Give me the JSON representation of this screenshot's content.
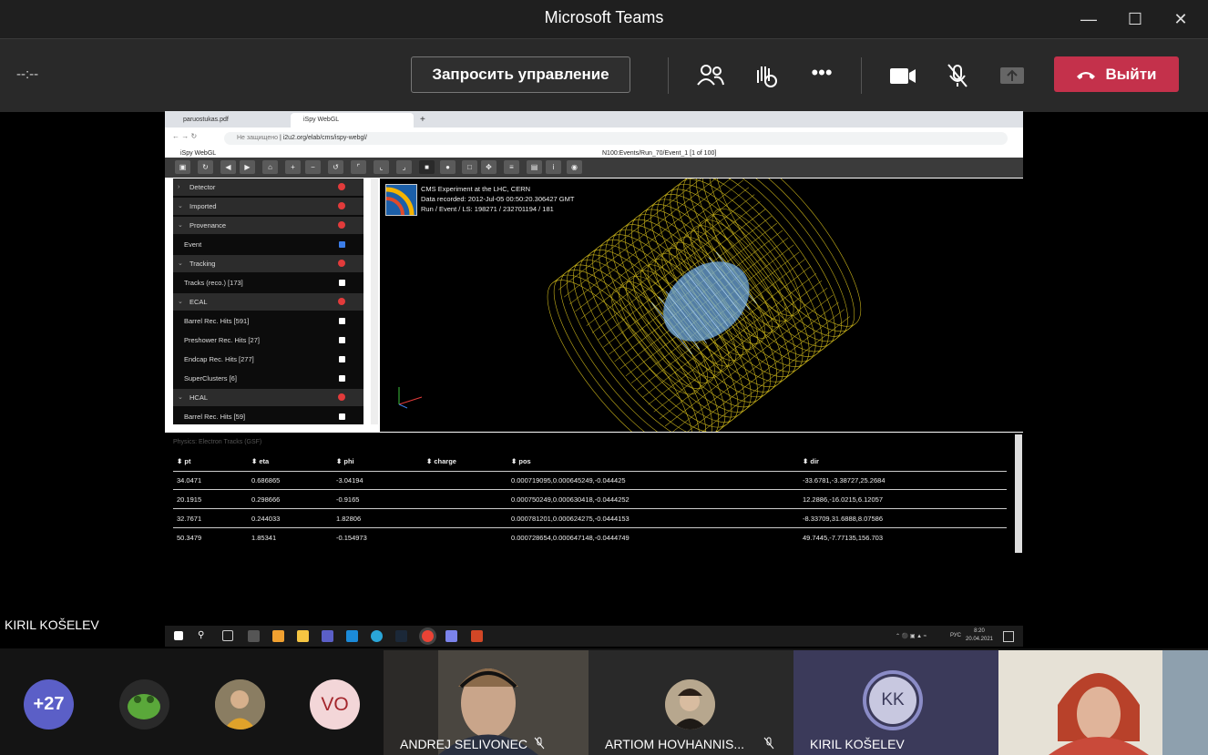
{
  "window": {
    "title": "Microsoft Teams"
  },
  "toolbar": {
    "timer": "--:--",
    "request_control": "Запросить управление",
    "leave": "Выйти"
  },
  "browser": {
    "tabs": [
      "paruostukas.pdf",
      "iSpy WebGL"
    ],
    "url_prefix": "Не защищено",
    "url": "i2u2.org/elab/cms/ispy-webgl/"
  },
  "ispy": {
    "app_name": "iSpy WebGL",
    "event_path": "N100:Events/Run_70/Event_1 [1 of 100]",
    "info": [
      "CMS Experiment at the LHC, CERN",
      "Data recorded: 2012-Jul-05 00:50:20.306427 GMT",
      "Run / Event / LS: 198271 / 232701194 / 181"
    ],
    "tree": [
      {
        "label": "Detector",
        "type": "group",
        "open": false
      },
      {
        "label": "Imported",
        "type": "group",
        "open": true
      },
      {
        "label": "Provenance",
        "type": "group",
        "open": true
      },
      {
        "label": "Event",
        "type": "item",
        "checked": true
      },
      {
        "label": "Tracking",
        "type": "group",
        "open": true
      },
      {
        "label": "Tracks (reco.) [173]",
        "type": "item",
        "checked": false
      },
      {
        "label": "ECAL",
        "type": "group",
        "open": true
      },
      {
        "label": "Barrel Rec. Hits [591]",
        "type": "item",
        "checked": false
      },
      {
        "label": "Preshower Rec. Hits [27]",
        "type": "item",
        "checked": false
      },
      {
        "label": "Endcap Rec. Hits [277]",
        "type": "item",
        "checked": false
      },
      {
        "label": "SuperClusters [6]",
        "type": "item",
        "checked": false
      },
      {
        "label": "HCAL",
        "type": "group",
        "open": true
      },
      {
        "label": "Barrel Rec. Hits [59]",
        "type": "item",
        "checked": false
      }
    ],
    "table": {
      "title": "Physics: Electron Tracks (GSF)",
      "headers": [
        "pt",
        "eta",
        "phi",
        "charge",
        "pos",
        "dir"
      ],
      "rows": [
        [
          "34.0471",
          "0.686865",
          "-3.04194",
          "",
          "0.000719095,0.000645249,-0.044425",
          "-33.6781,-3.38727,25.2684"
        ],
        [
          "20.1915",
          "0.298666",
          "-0.9165",
          "",
          "0.000750249,0.000630418,-0.0444252",
          "12.2886,-16.0215,6.12057"
        ],
        [
          "32.7671",
          "0.244033",
          "1.82806",
          "",
          "0.000781201,0.000624275,-0.0444153",
          "-8.33709,31.6888,8.07586"
        ],
        [
          "50.3479",
          "1.85341",
          "-0.154973",
          "",
          "0.000728654,0.000647148,-0.0444749",
          "49.7445,-7.77135,156.703"
        ]
      ]
    }
  },
  "presenter_name": "KIRIL KOŠELEV",
  "taskbar": {
    "lang": "РУС",
    "time": "8:20",
    "date": "20.04.2021"
  },
  "participants": {
    "overflow": "+27",
    "initials_vo": "VO",
    "andrej": "ANDREJ SELIVONEC",
    "artiom": "ARTIOM HOVHANNIS...",
    "kiril_initials": "KK",
    "kiril": "KIRIL KOŠELEV"
  },
  "colors": {
    "leave": "#c4314b",
    "wireframe": "#c8b21a",
    "tracker": "#6fa8dc",
    "avatar_overflow": "#5b5fc7",
    "avatar_vo": "#f3d6d8"
  }
}
